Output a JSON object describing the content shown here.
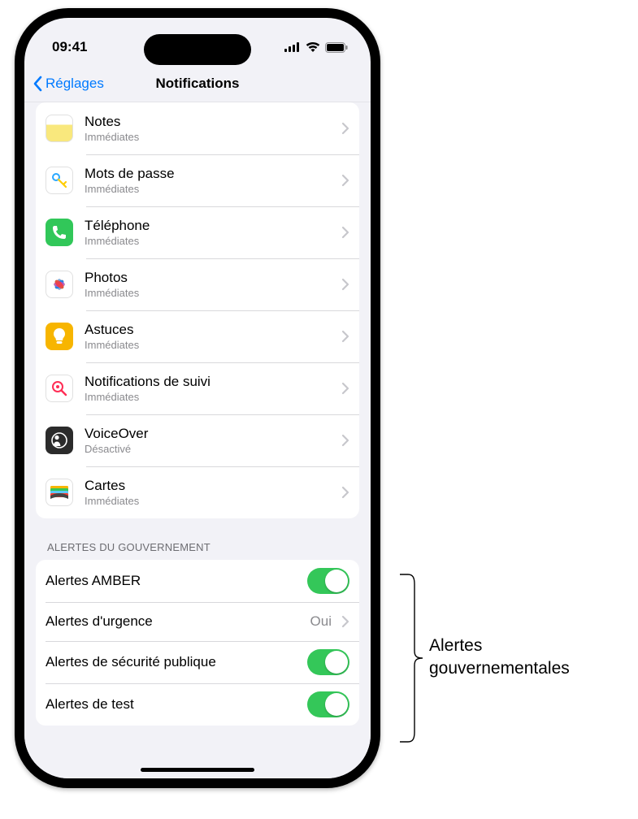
{
  "status": {
    "time": "09:41"
  },
  "nav": {
    "back": "Réglages",
    "title": "Notifications"
  },
  "apps": [
    {
      "name": "Notes",
      "sub": "Immédiates",
      "icon": "notes"
    },
    {
      "name": "Mots de passe",
      "sub": "Immédiates",
      "icon": "passwords"
    },
    {
      "name": "Téléphone",
      "sub": "Immédiates",
      "icon": "phone"
    },
    {
      "name": "Photos",
      "sub": "Immédiates",
      "icon": "photos"
    },
    {
      "name": "Astuces",
      "sub": "Immédiates",
      "icon": "tips"
    },
    {
      "name": "Notifications de suivi",
      "sub": "Immédiates",
      "icon": "tracking"
    },
    {
      "name": "VoiceOver",
      "sub": "Désactivé",
      "icon": "voiceover"
    },
    {
      "name": "Cartes",
      "sub": "Immédiates",
      "icon": "wallet"
    }
  ],
  "gov": {
    "header": "ALERTES DU GOUVERNEMENT",
    "items": [
      {
        "label": "Alertes AMBER",
        "type": "switch",
        "value": true
      },
      {
        "label": "Alertes d'urgence",
        "type": "link",
        "value_text": "Oui"
      },
      {
        "label": "Alertes de sécurité publique",
        "type": "switch",
        "value": true
      },
      {
        "label": "Alertes de test",
        "type": "switch",
        "value": true
      }
    ]
  },
  "callout": {
    "line1": "Alertes",
    "line2": "gouvernementales"
  }
}
